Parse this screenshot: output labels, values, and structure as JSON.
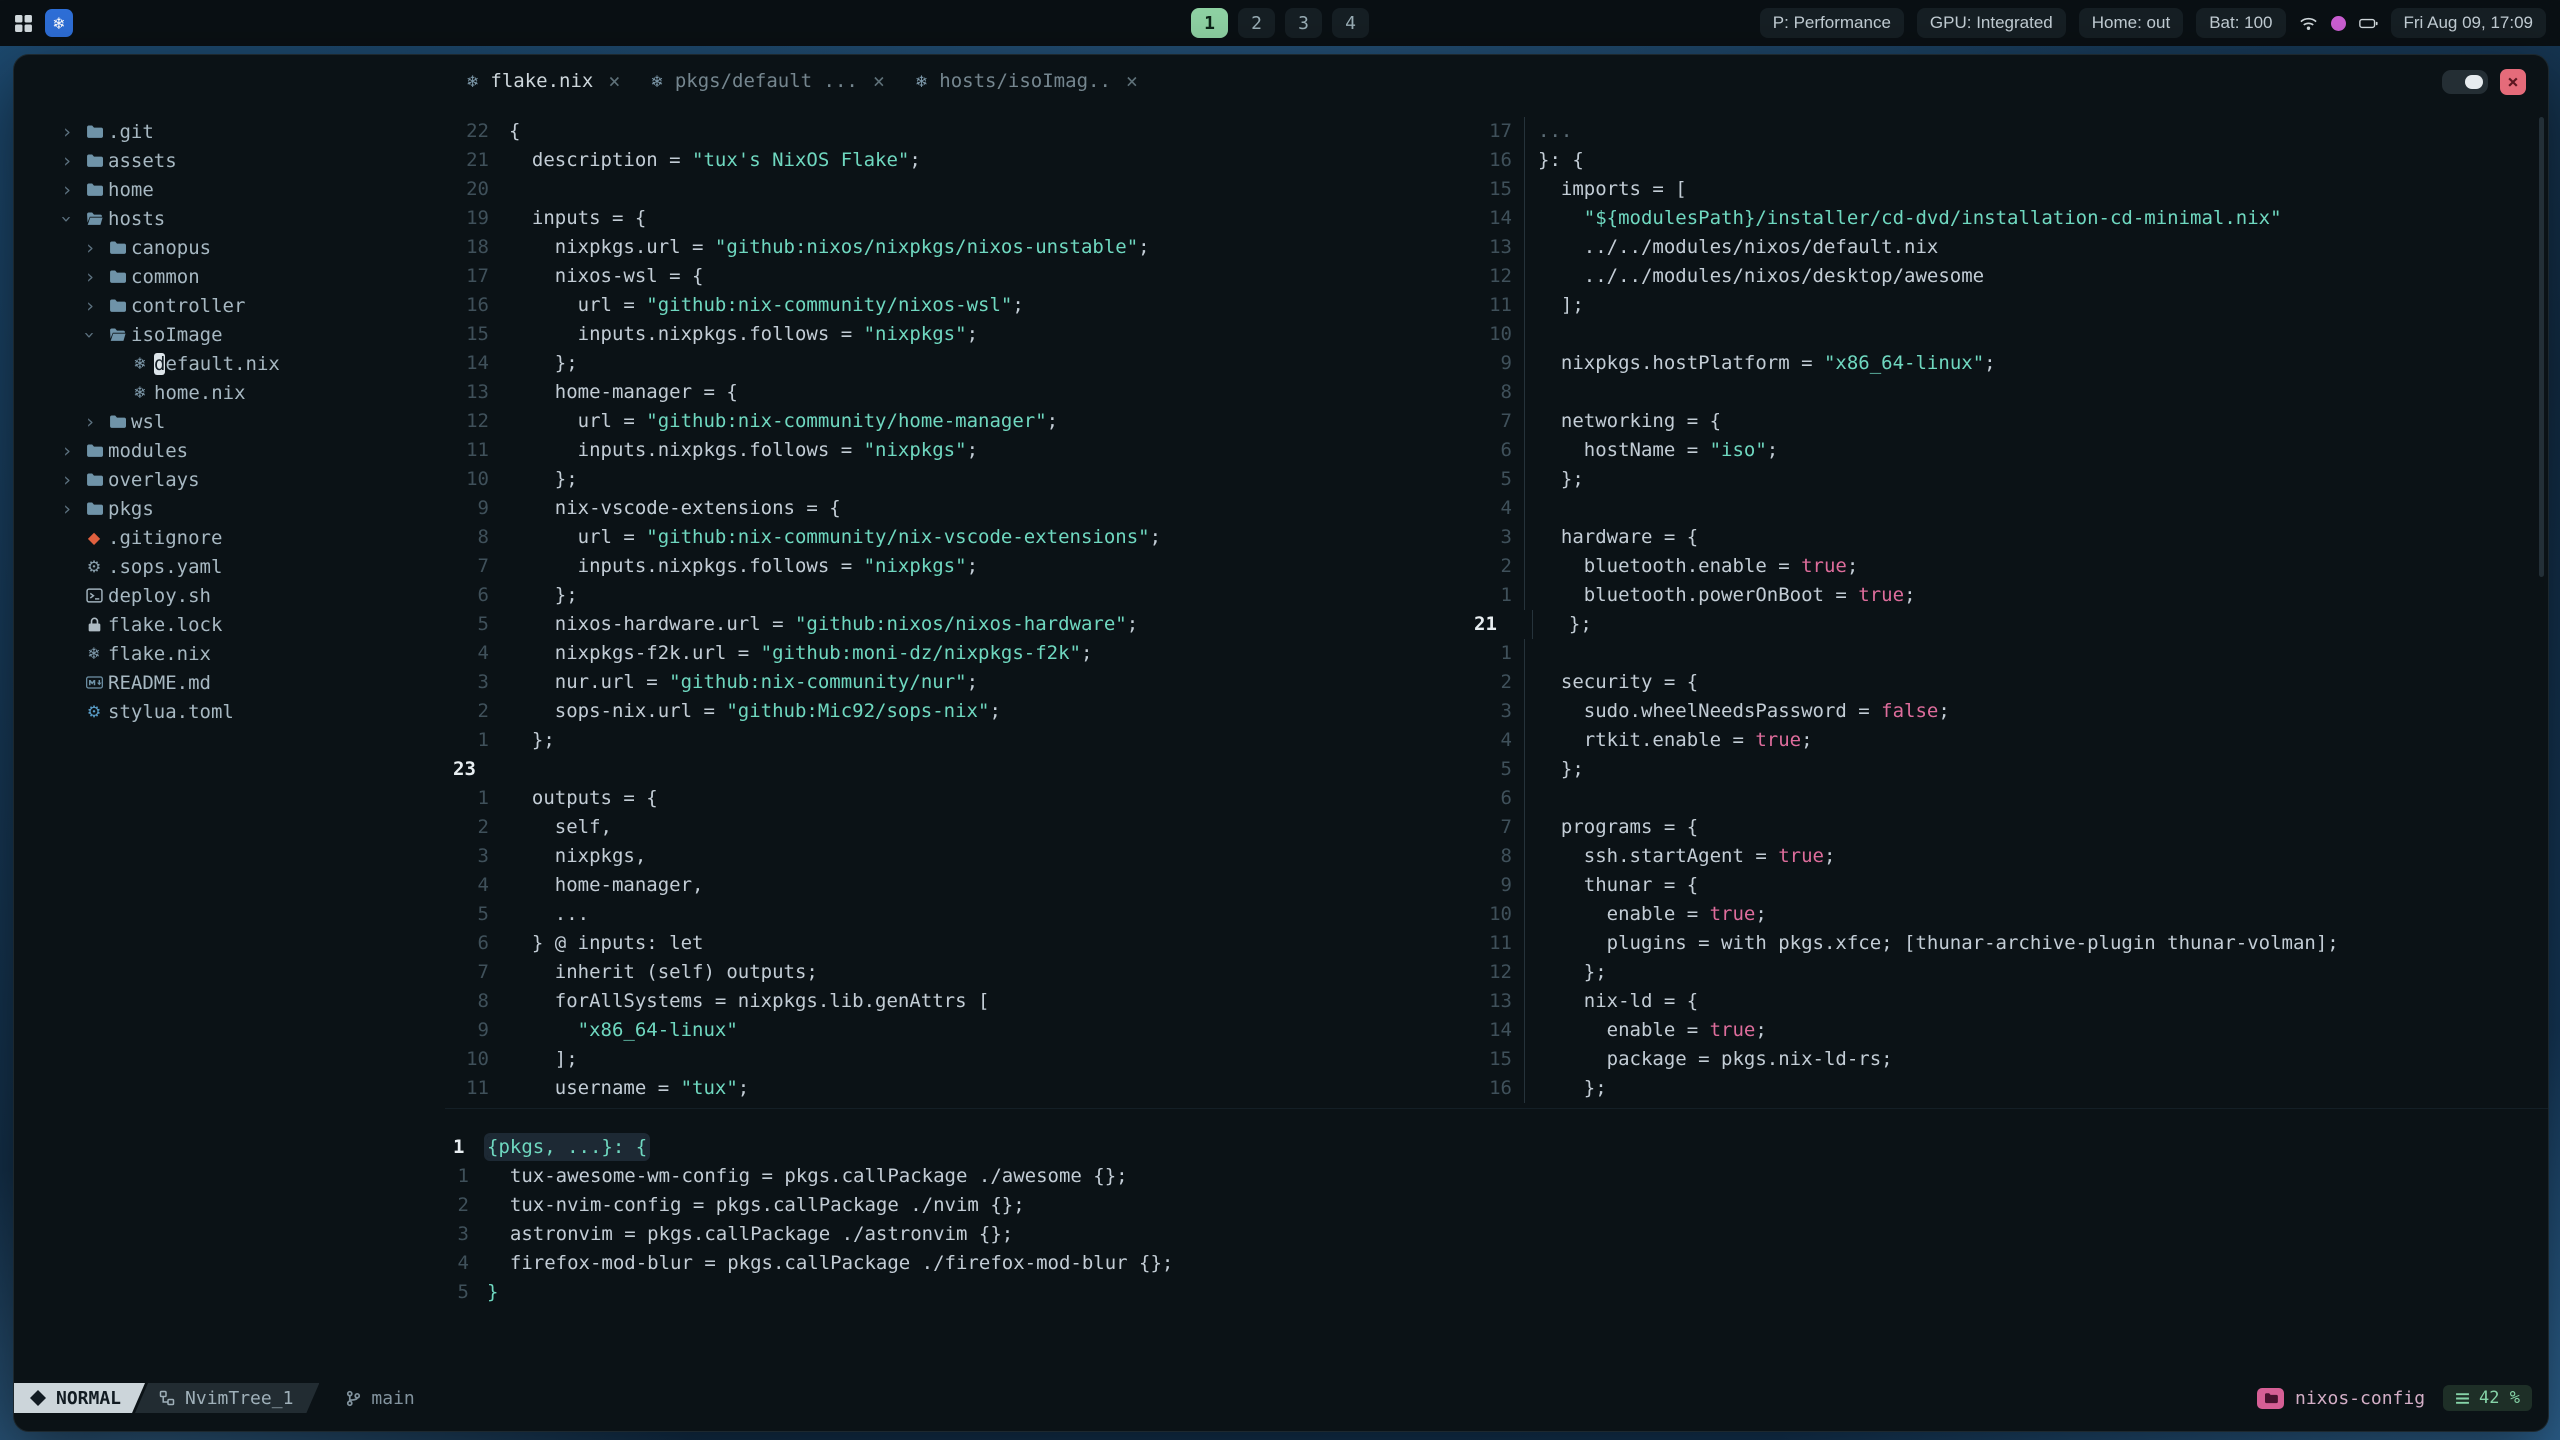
{
  "topbar": {
    "workspaces": [
      {
        "label": "1",
        "active": true
      },
      {
        "label": "2",
        "active": false
      },
      {
        "label": "3",
        "active": false
      },
      {
        "label": "4",
        "active": false
      }
    ],
    "status_chips": [
      "P: Performance",
      "GPU: Integrated",
      "Home: out",
      "Bat: 100"
    ],
    "clock": "Fri Aug 09, 17:09"
  },
  "window": {
    "tabs": [
      {
        "label": "flake.nix",
        "icon": "nix",
        "active": true
      },
      {
        "label": "pkgs/default ...",
        "icon": "nix",
        "active": false
      },
      {
        "label": "hosts/isoImag..",
        "icon": "nix",
        "active": false
      }
    ]
  },
  "tree": {
    "items": [
      {
        "label": ".git",
        "icon": "folder",
        "chev": "closed",
        "indent": 0
      },
      {
        "label": "assets",
        "icon": "folder",
        "chev": "closed",
        "indent": 0
      },
      {
        "label": "home",
        "icon": "folder",
        "chev": "closed",
        "indent": 0
      },
      {
        "label": "hosts",
        "icon": "folder-open",
        "chev": "open",
        "indent": 0
      },
      {
        "label": "canopus",
        "icon": "folder",
        "chev": "closed",
        "indent": 1
      },
      {
        "label": "common",
        "icon": "folder",
        "chev": "closed",
        "indent": 1
      },
      {
        "label": "controller",
        "icon": "folder",
        "chev": "closed",
        "indent": 1
      },
      {
        "label": "isoImage",
        "icon": "folder-open",
        "chev": "open",
        "indent": 1
      },
      {
        "label": "default.nix",
        "icon": "nix",
        "indent": 2,
        "cursor": true
      },
      {
        "label": "home.nix",
        "icon": "nix",
        "indent": 2
      },
      {
        "label": "wsl",
        "icon": "folder",
        "chev": "closed",
        "indent": 1
      },
      {
        "label": "modules",
        "icon": "folder",
        "chev": "closed",
        "indent": 0
      },
      {
        "label": "overlays",
        "icon": "folder",
        "chev": "closed",
        "indent": 0
      },
      {
        "label": "pkgs",
        "icon": "folder",
        "chev": "closed",
        "indent": 0
      },
      {
        "label": ".gitignore",
        "icon": "git",
        "indent": 0
      },
      {
        "label": ".sops.yaml",
        "icon": "gear",
        "indent": 0
      },
      {
        "label": "deploy.sh",
        "icon": "shell",
        "indent": 0
      },
      {
        "label": "flake.lock",
        "icon": "lock",
        "indent": 0
      },
      {
        "label": "flake.nix",
        "icon": "nix",
        "indent": 0
      },
      {
        "label": "README.md",
        "icon": "markdown",
        "indent": 0
      },
      {
        "label": "stylua.toml",
        "icon": "toml",
        "indent": 0
      }
    ]
  },
  "editors": {
    "left": {
      "lines": [
        {
          "n": 22,
          "segs": [
            [
              "{",
              "p"
            ]
          ]
        },
        {
          "n": 21,
          "segs": [
            [
              "  description = ",
              "p"
            ],
            [
              "\"tux's NixOS Flake\"",
              "s"
            ],
            [
              ";",
              "p"
            ]
          ]
        },
        {
          "n": 20,
          "segs": []
        },
        {
          "n": 19,
          "segs": [
            [
              "  inputs = {",
              "p"
            ]
          ]
        },
        {
          "n": 18,
          "segs": [
            [
              "    nixpkgs.url = ",
              "p"
            ],
            [
              "\"github:nixos/nixpkgs/nixos-unstable\"",
              "s"
            ],
            [
              ";",
              "p"
            ]
          ]
        },
        {
          "n": 17,
          "segs": [
            [
              "    nixos-wsl = {",
              "p"
            ]
          ]
        },
        {
          "n": 16,
          "segs": [
            [
              "      url = ",
              "p"
            ],
            [
              "\"github:nix-community/nixos-wsl\"",
              "s"
            ],
            [
              ";",
              "p"
            ]
          ]
        },
        {
          "n": 15,
          "segs": [
            [
              "      inputs.nixpkgs.follows = ",
              "p"
            ],
            [
              "\"nixpkgs\"",
              "s"
            ],
            [
              ";",
              "p"
            ]
          ]
        },
        {
          "n": 14,
          "segs": [
            [
              "    };",
              "p"
            ]
          ]
        },
        {
          "n": 13,
          "segs": [
            [
              "    home-manager = {",
              "p"
            ]
          ]
        },
        {
          "n": 12,
          "segs": [
            [
              "      url = ",
              "p"
            ],
            [
              "\"github:nix-community/home-manager\"",
              "s"
            ],
            [
              ";",
              "p"
            ]
          ]
        },
        {
          "n": 11,
          "segs": [
            [
              "      inputs.nixpkgs.follows = ",
              "p"
            ],
            [
              "\"nixpkgs\"",
              "s"
            ],
            [
              ";",
              "p"
            ]
          ]
        },
        {
          "n": 10,
          "segs": [
            [
              "    };",
              "p"
            ]
          ]
        },
        {
          "n": 9,
          "segs": [
            [
              "    nix-vscode-extensions = {",
              "p"
            ]
          ]
        },
        {
          "n": 8,
          "segs": [
            [
              "      url = ",
              "p"
            ],
            [
              "\"github:nix-community/nix-vscode-extensions\"",
              "s"
            ],
            [
              ";",
              "p"
            ]
          ]
        },
        {
          "n": 7,
          "segs": [
            [
              "      inputs.nixpkgs.follows = ",
              "p"
            ],
            [
              "\"nixpkgs\"",
              "s"
            ],
            [
              ";",
              "p"
            ]
          ]
        },
        {
          "n": 6,
          "segs": [
            [
              "    };",
              "p"
            ]
          ]
        },
        {
          "n": 5,
          "segs": [
            [
              "    nixos-hardware.url = ",
              "p"
            ],
            [
              "\"github:nixos/nixos-hardware\"",
              "s"
            ],
            [
              ";",
              "p"
            ]
          ]
        },
        {
          "n": 4,
          "segs": [
            [
              "    nixpkgs-f2k.url = ",
              "p"
            ],
            [
              "\"github:moni-dz/nixpkgs-f2k\"",
              "s"
            ],
            [
              ";",
              "p"
            ]
          ]
        },
        {
          "n": 3,
          "segs": [
            [
              "    nur.url = ",
              "p"
            ],
            [
              "\"github:nix-community/nur\"",
              "s"
            ],
            [
              ";",
              "p"
            ]
          ]
        },
        {
          "n": 2,
          "segs": [
            [
              "    sops-nix.url = ",
              "p"
            ],
            [
              "\"github:Mic92/sops-nix\"",
              "s"
            ],
            [
              ";",
              "p"
            ]
          ]
        },
        {
          "n": 1,
          "segs": [
            [
              "  };",
              "p"
            ]
          ]
        },
        {
          "n": 23,
          "cur": true,
          "segs": []
        },
        {
          "n": 1,
          "segs": [
            [
              "  outputs = {",
              "p"
            ]
          ]
        },
        {
          "n": 2,
          "segs": [
            [
              "    self,",
              "p"
            ]
          ]
        },
        {
          "n": 3,
          "segs": [
            [
              "    nixpkgs,",
              "p"
            ]
          ]
        },
        {
          "n": 4,
          "segs": [
            [
              "    home-manager,",
              "p"
            ]
          ]
        },
        {
          "n": 5,
          "segs": [
            [
              "    ...",
              "p"
            ]
          ]
        },
        {
          "n": 6,
          "segs": [
            [
              "  } @ inputs: let",
              "p"
            ]
          ]
        },
        {
          "n": 7,
          "segs": [
            [
              "    inherit (self) outputs;",
              "p"
            ]
          ]
        },
        {
          "n": 8,
          "segs": [
            [
              "    forAllSystems = nixpkgs.lib.genAttrs [",
              "p"
            ]
          ]
        },
        {
          "n": 9,
          "segs": [
            [
              "      ",
              "p"
            ],
            [
              "\"x86_64-linux\"",
              "s"
            ]
          ]
        },
        {
          "n": 10,
          "segs": [
            [
              "    ];",
              "p"
            ]
          ]
        },
        {
          "n": 11,
          "segs": [
            [
              "    username = ",
              "p"
            ],
            [
              "\"tux\"",
              "s"
            ],
            [
              ";",
              "p"
            ]
          ]
        }
      ]
    },
    "right": {
      "lines": [
        {
          "n": 17,
          "segs": [
            [
              "...",
              "c"
            ]
          ]
        },
        {
          "n": 16,
          "segs": [
            [
              "}: {",
              "p"
            ]
          ]
        },
        {
          "n": 15,
          "segs": [
            [
              "  imports = [",
              "p"
            ]
          ]
        },
        {
          "n": 14,
          "segs": [
            [
              "    ",
              "p"
            ],
            [
              "\"${modulesPath}/installer/cd-dvd/installation-cd-minimal.nix\"",
              "s"
            ]
          ]
        },
        {
          "n": 13,
          "segs": [
            [
              "    ../../modules/nixos/default.nix",
              "p"
            ]
          ]
        },
        {
          "n": 12,
          "segs": [
            [
              "    ../../modules/nixos/desktop/awesome",
              "p"
            ]
          ]
        },
        {
          "n": 11,
          "segs": [
            [
              "  ];",
              "p"
            ]
          ]
        },
        {
          "n": 10,
          "segs": []
        },
        {
          "n": 9,
          "segs": [
            [
              "  nixpkgs.hostPlatform = ",
              "p"
            ],
            [
              "\"x86_64-linux\"",
              "s"
            ],
            [
              ";",
              "p"
            ]
          ]
        },
        {
          "n": 8,
          "segs": []
        },
        {
          "n": 7,
          "segs": [
            [
              "  networking = {",
              "p"
            ]
          ]
        },
        {
          "n": 6,
          "segs": [
            [
              "    hostName = ",
              "p"
            ],
            [
              "\"iso\"",
              "s"
            ],
            [
              ";",
              "p"
            ]
          ]
        },
        {
          "n": 5,
          "segs": [
            [
              "  };",
              "p"
            ]
          ]
        },
        {
          "n": 4,
          "segs": []
        },
        {
          "n": 3,
          "segs": [
            [
              "  hardware = {",
              "p"
            ]
          ]
        },
        {
          "n": 2,
          "segs": [
            [
              "    bluetooth.enable = ",
              "p"
            ],
            [
              "true",
              "b"
            ],
            [
              ";",
              "p"
            ]
          ]
        },
        {
          "n": 1,
          "segs": [
            [
              "    bluetooth.powerOnBoot = ",
              "p"
            ],
            [
              "true",
              "b"
            ],
            [
              ";",
              "p"
            ]
          ]
        },
        {
          "n": 21,
          "cur": true,
          "segs": [
            [
              "  };",
              "p"
            ]
          ]
        },
        {
          "n": 1,
          "segs": []
        },
        {
          "n": 2,
          "segs": [
            [
              "  security = {",
              "p"
            ]
          ]
        },
        {
          "n": 3,
          "segs": [
            [
              "    sudo.wheelNeedsPassword = ",
              "p"
            ],
            [
              "false",
              "b"
            ],
            [
              ";",
              "p"
            ]
          ]
        },
        {
          "n": 4,
          "segs": [
            [
              "    rtkit.enable = ",
              "p"
            ],
            [
              "true",
              "b"
            ],
            [
              ";",
              "p"
            ]
          ]
        },
        {
          "n": 5,
          "segs": [
            [
              "  };",
              "p"
            ]
          ]
        },
        {
          "n": 6,
          "segs": []
        },
        {
          "n": 7,
          "segs": [
            [
              "  programs = {",
              "p"
            ]
          ]
        },
        {
          "n": 8,
          "segs": [
            [
              "    ssh.startAgent = ",
              "p"
            ],
            [
              "true",
              "b"
            ],
            [
              ";",
              "p"
            ]
          ]
        },
        {
          "n": 9,
          "segs": [
            [
              "    thunar = {",
              "p"
            ]
          ]
        },
        {
          "n": 10,
          "segs": [
            [
              "      enable = ",
              "p"
            ],
            [
              "true",
              "b"
            ],
            [
              ";",
              "p"
            ]
          ]
        },
        {
          "n": 11,
          "segs": [
            [
              "      plugins = with pkgs.xfce; [thunar-archive-plugin thunar-volman];",
              "p"
            ]
          ]
        },
        {
          "n": 12,
          "segs": [
            [
              "    };",
              "p"
            ]
          ]
        },
        {
          "n": 13,
          "segs": [
            [
              "    nix-ld = {",
              "p"
            ]
          ]
        },
        {
          "n": 14,
          "segs": [
            [
              "      enable = ",
              "p"
            ],
            [
              "true",
              "b"
            ],
            [
              ";",
              "p"
            ]
          ]
        },
        {
          "n": 15,
          "segs": [
            [
              "      package = pkgs.nix-ld-rs;",
              "p"
            ]
          ]
        },
        {
          "n": 16,
          "segs": [
            [
              "    };",
              "p"
            ]
          ]
        }
      ]
    },
    "bottom": {
      "lines": [
        {
          "n": 1,
          "cur": true,
          "hl": true,
          "segs": [
            [
              "{pkgs, ...}: {",
              "t"
            ]
          ]
        },
        {
          "n": 1,
          "segs": [
            [
              "  tux-awesome-wm-config = pkgs.callPackage ./awesome {};",
              "p"
            ]
          ]
        },
        {
          "n": 2,
          "segs": [
            [
              "  tux-nvim-config = pkgs.callPackage ./nvim {};",
              "p"
            ]
          ]
        },
        {
          "n": 3,
          "segs": [
            [
              "  astronvim = pkgs.callPackage ./astronvim {};",
              "p"
            ]
          ]
        },
        {
          "n": 4,
          "segs": [
            [
              "  firefox-mod-blur = pkgs.callPackage ./firefox-mod-blur {};",
              "p"
            ]
          ]
        },
        {
          "n": 5,
          "segs": [
            [
              "}",
              "t"
            ]
          ]
        }
      ]
    }
  },
  "statusline": {
    "mode": "NORMAL",
    "buffer": "NvimTree_1",
    "branch": "main",
    "project": "nixos-config",
    "scroll": "42 %"
  },
  "colors": {
    "string_teal": "#6fd8c0",
    "boolean_pink": "#de6d9c",
    "workspace_active": "#8fd3a4",
    "close_button": "#e56b7a",
    "project_pink": "#d65f95",
    "scroll_green": "#86d4a8",
    "git_icon_orange": "#e0603f",
    "logo_blue": "#2e6fd8"
  }
}
